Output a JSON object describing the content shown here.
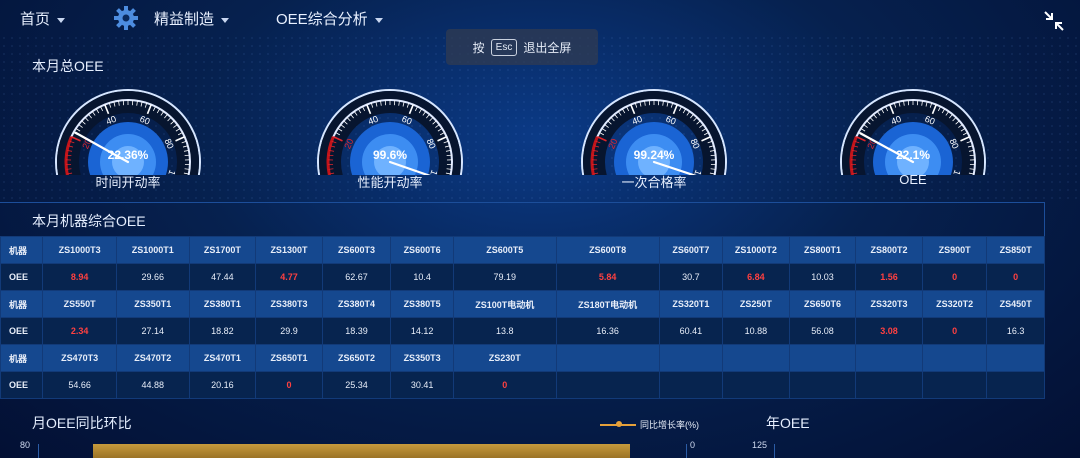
{
  "nav": {
    "home": "首页",
    "lean": "精益制造",
    "oee_analysis": "OEE综合分析"
  },
  "esc_hint": {
    "press": "按",
    "key": "Esc",
    "action": "退出全屏"
  },
  "sections": {
    "monthly_oee": "本月总OEE",
    "machine_oee": "本月机器综合OEE",
    "mom_yoy": "月OEE同比环比",
    "yearly_oee": "年OEE"
  },
  "gauges": [
    {
      "value": "22.36%",
      "fraction": 0.2236,
      "label": "时间开动率"
    },
    {
      "value": "99.6%",
      "fraction": 0.996,
      "label": "性能开动率"
    },
    {
      "value": "99.24%",
      "fraction": 0.9924,
      "label": "一次合格率"
    },
    {
      "value": "22.1%",
      "fraction": 0.221,
      "label": "OEE"
    }
  ],
  "gauge_ticks": [
    "0",
    "20",
    "40",
    "60",
    "80",
    "100"
  ],
  "table": {
    "machine_label": "机器",
    "oee_label": "OEE",
    "rows": [
      {
        "machines": [
          "ZS1000T3",
          "ZS1000T1",
          "ZS1700T",
          "ZS1300T",
          "ZS600T3",
          "ZS600T6",
          "ZS600T5",
          "ZS600T8",
          "ZS600T7",
          "ZS1000T2",
          "ZS800T1",
          "ZS800T2",
          "ZS900T",
          "ZS850T"
        ],
        "values": [
          {
            "v": "8.94",
            "red": true
          },
          {
            "v": "29.66",
            "red": false
          },
          {
            "v": "47.44",
            "red": false
          },
          {
            "v": "4.77",
            "red": true
          },
          {
            "v": "62.67",
            "red": false
          },
          {
            "v": "10.4",
            "red": false
          },
          {
            "v": "79.19",
            "red": false
          },
          {
            "v": "5.84",
            "red": true
          },
          {
            "v": "30.7",
            "red": false
          },
          {
            "v": "6.84",
            "red": true
          },
          {
            "v": "10.03",
            "red": false
          },
          {
            "v": "1.56",
            "red": true
          },
          {
            "v": "0",
            "red": true
          },
          {
            "v": "0",
            "red": true
          }
        ]
      },
      {
        "machines": [
          "ZS550T",
          "ZS350T1",
          "ZS380T1",
          "ZS380T3",
          "ZS380T4",
          "ZS380T5",
          "ZS100T电动机",
          "ZS180T电动机",
          "ZS320T1",
          "ZS250T",
          "ZS650T6",
          "ZS320T3",
          "ZS320T2",
          "ZS450T"
        ],
        "values": [
          {
            "v": "2.34",
            "red": true
          },
          {
            "v": "27.14",
            "red": false
          },
          {
            "v": "18.82",
            "red": false
          },
          {
            "v": "29.9",
            "red": false
          },
          {
            "v": "18.39",
            "red": false
          },
          {
            "v": "14.12",
            "red": false
          },
          {
            "v": "13.8",
            "red": false
          },
          {
            "v": "16.36",
            "red": false
          },
          {
            "v": "60.41",
            "red": false
          },
          {
            "v": "10.88",
            "red": false
          },
          {
            "v": "56.08",
            "red": false
          },
          {
            "v": "3.08",
            "red": true
          },
          {
            "v": "0",
            "red": true
          },
          {
            "v": "16.3",
            "red": false
          }
        ]
      },
      {
        "machines": [
          "ZS470T3",
          "ZS470T2",
          "ZS470T1",
          "ZS650T1",
          "ZS650T2",
          "ZS350T3",
          "ZS230T",
          "",
          "",
          "",
          "",
          "",
          "",
          ""
        ],
        "values": [
          {
            "v": "54.66",
            "red": false
          },
          {
            "v": "44.88",
            "red": false
          },
          {
            "v": "20.16",
            "red": false
          },
          {
            "v": "0",
            "red": true
          },
          {
            "v": "25.34",
            "red": false
          },
          {
            "v": "30.41",
            "red": false
          },
          {
            "v": "0",
            "red": true
          },
          {
            "v": "",
            "red": false
          },
          {
            "v": "",
            "red": false
          },
          {
            "v": "",
            "red": false
          },
          {
            "v": "",
            "red": false
          },
          {
            "v": "",
            "red": false
          },
          {
            "v": "",
            "red": false
          },
          {
            "v": "",
            "red": false
          }
        ]
      }
    ]
  },
  "bottom_chart": {
    "legend": "同比增长率(%)",
    "y_left_top": "80",
    "y_right_top": "0",
    "year_y_top": "125"
  },
  "colors": {
    "accent_red": "#ff4040",
    "bar_gold": "#c79a3c",
    "header_blue": "#15488f"
  }
}
